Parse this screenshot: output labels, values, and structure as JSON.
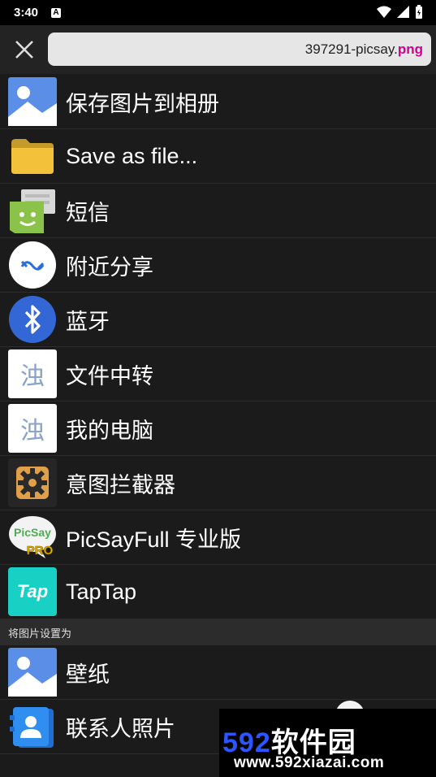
{
  "status_bar": {
    "time": "3:40",
    "notification_letter": "A"
  },
  "toolbar": {
    "filename_base": "397291-picsay.",
    "filename_ext": "png"
  },
  "share_targets": [
    {
      "label": "保存图片到相册",
      "icon": "gallery-icon"
    },
    {
      "label": "Save as file...",
      "icon": "folder-icon"
    },
    {
      "label": "短信",
      "icon": "sms-icon"
    },
    {
      "label": "附近分享",
      "icon": "nearby-share-icon"
    },
    {
      "label": "蓝牙",
      "icon": "bluetooth-icon"
    },
    {
      "label": "文件中转",
      "icon": "file-transfer-icon",
      "glyph": "浊"
    },
    {
      "label": "我的电脑",
      "icon": "my-computer-icon",
      "glyph": "浊"
    },
    {
      "label": "意图拦截器",
      "icon": "gear-icon"
    },
    {
      "label": "PicSayFull 专业版",
      "icon": "picsay-pro-icon",
      "badge_top": "PicSay",
      "badge_bottom": "PRO"
    },
    {
      "label": "TapTap",
      "icon": "taptap-icon",
      "badge": "Tap"
    }
  ],
  "set_as": {
    "header": "将图片设置为",
    "items": [
      {
        "label": "壁纸",
        "icon": "gallery-icon"
      },
      {
        "label": "联系人照片",
        "icon": "contact-icon"
      }
    ]
  },
  "watermark": {
    "brand_number": "592",
    "brand_text": "软件园",
    "url": "www.592xiazai.com"
  },
  "colors": {
    "background": "#1b1b1b",
    "field": "#e6e6e6",
    "extension": "#d2008f",
    "watermark_blue": "#2a55ff"
  }
}
